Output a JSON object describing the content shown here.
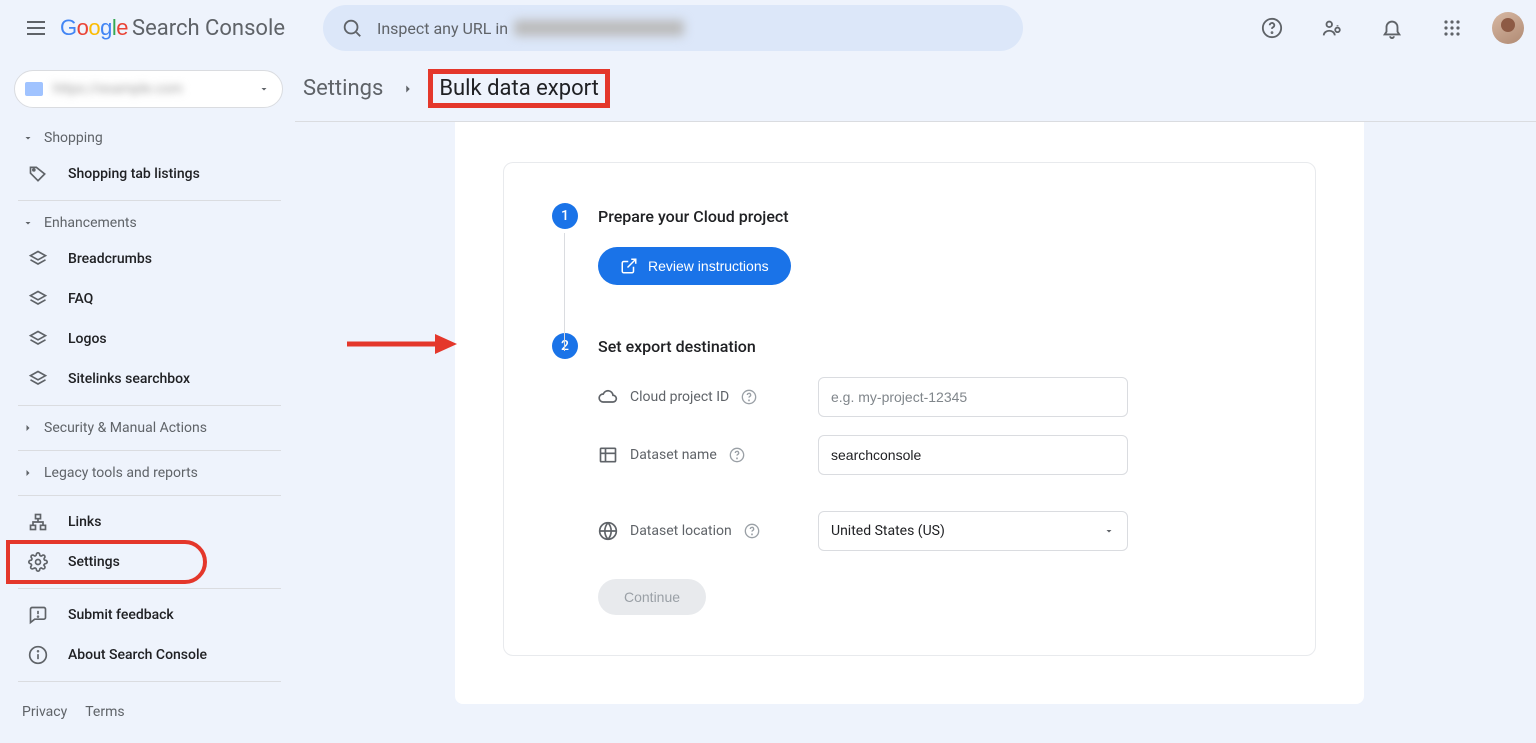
{
  "header": {
    "app_name": "Search Console",
    "search_placeholder": "Inspect any URL in"
  },
  "property": {
    "name": "https://example.com"
  },
  "sidebar": {
    "sections": {
      "shopping": {
        "label": "Shopping",
        "items": [
          "Shopping tab listings"
        ]
      },
      "enhancements": {
        "label": "Enhancements",
        "items": [
          "Breadcrumbs",
          "FAQ",
          "Logos",
          "Sitelinks searchbox"
        ]
      },
      "security": {
        "label": "Security & Manual Actions"
      },
      "legacy": {
        "label": "Legacy tools and reports"
      }
    },
    "bottom": {
      "links": "Links",
      "settings": "Settings",
      "feedback": "Submit feedback",
      "about": "About Search Console"
    },
    "footer": {
      "privacy": "Privacy",
      "terms": "Terms"
    }
  },
  "breadcrumb": {
    "parent": "Settings",
    "current": "Bulk data export"
  },
  "steps": {
    "s1": {
      "num": "1",
      "title": "Prepare your Cloud project",
      "button": "Review instructions"
    },
    "s2": {
      "num": "2",
      "title": "Set export destination",
      "fields": {
        "project_id": {
          "label": "Cloud project ID",
          "placeholder": "e.g. my-project-12345",
          "value": ""
        },
        "dataset_name": {
          "label": "Dataset name",
          "value": "searchconsole"
        },
        "dataset_location": {
          "label": "Dataset location",
          "value": "United States (US)"
        }
      },
      "continue": "Continue"
    }
  }
}
